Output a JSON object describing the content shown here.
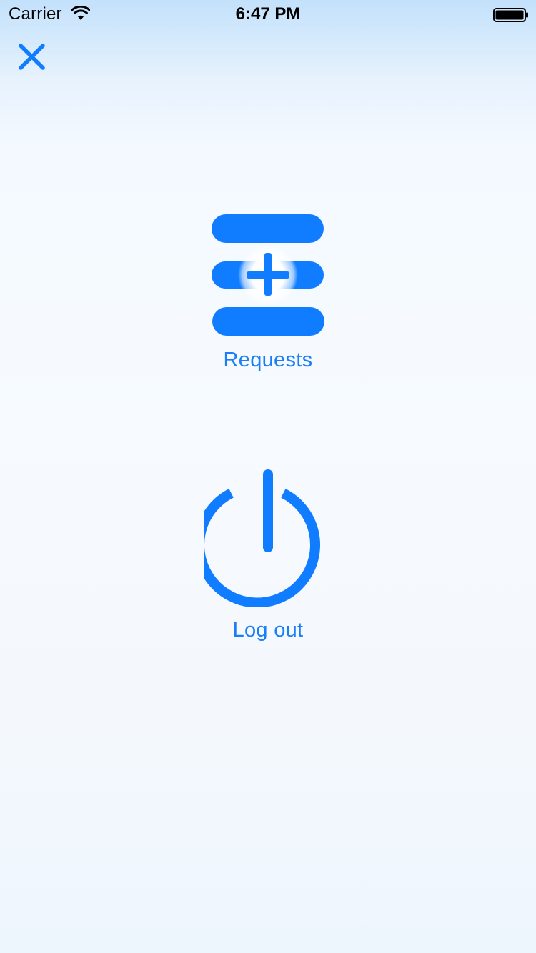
{
  "status_bar": {
    "carrier": "Carrier",
    "time": "6:47 PM"
  },
  "colors": {
    "accent": "#107cff",
    "label": "#1a7ef7",
    "background_top": "#c3e1fb",
    "background": "#f7fbff"
  },
  "header": {
    "close_icon": "close-icon"
  },
  "menu": {
    "items": [
      {
        "label": "Requests",
        "icon": "requests-add-icon"
      },
      {
        "label": "Log out",
        "icon": "power-icon"
      }
    ]
  }
}
